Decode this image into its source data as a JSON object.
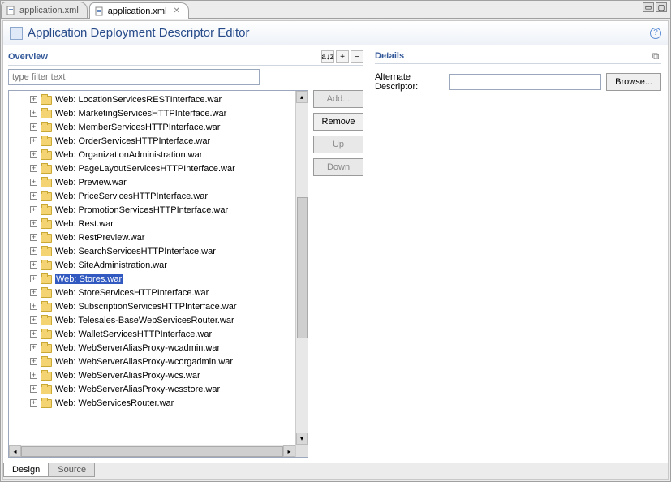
{
  "tabs": {
    "inactive": "application.xml",
    "active": "application.xml"
  },
  "title": "Application Deployment Descriptor Editor",
  "overview": {
    "title": "Overview",
    "filter_placeholder": "type filter text",
    "sort_tooltip": "a↓z",
    "expand_tooltip": "+",
    "collapse_tooltip": "−",
    "items": [
      "Web: LocationServicesRESTInterface.war",
      "Web: MarketingServicesHTTPInterface.war",
      "Web: MemberServicesHTTPInterface.war",
      "Web: OrderServicesHTTPInterface.war",
      "Web: OrganizationAdministration.war",
      "Web: PageLayoutServicesHTTPInterface.war",
      "Web: Preview.war",
      "Web: PriceServicesHTTPInterface.war",
      "Web: PromotionServicesHTTPInterface.war",
      "Web: Rest.war",
      "Web: RestPreview.war",
      "Web: SearchServicesHTTPInterface.war",
      "Web: SiteAdministration.war",
      "Web: Stores.war",
      "Web: StoreServicesHTTPInterface.war",
      "Web: SubscriptionServicesHTTPInterface.war",
      "Web: Telesales-BaseWebServicesRouter.war",
      "Web: WalletServicesHTTPInterface.war",
      "Web: WebServerAliasProxy-wcadmin.war",
      "Web: WebServerAliasProxy-wcorgadmin.war",
      "Web: WebServerAliasProxy-wcs.war",
      "Web: WebServerAliasProxy-wcsstore.war",
      "Web: WebServicesRouter.war"
    ],
    "selected_index": 13
  },
  "buttons": {
    "add": "Add...",
    "remove": "Remove",
    "up": "Up",
    "down": "Down"
  },
  "details": {
    "title": "Details",
    "alt_label": "Alternate Descriptor:",
    "alt_value": "",
    "browse": "Browse..."
  },
  "bottom_tabs": {
    "design": "Design",
    "source": "Source"
  }
}
